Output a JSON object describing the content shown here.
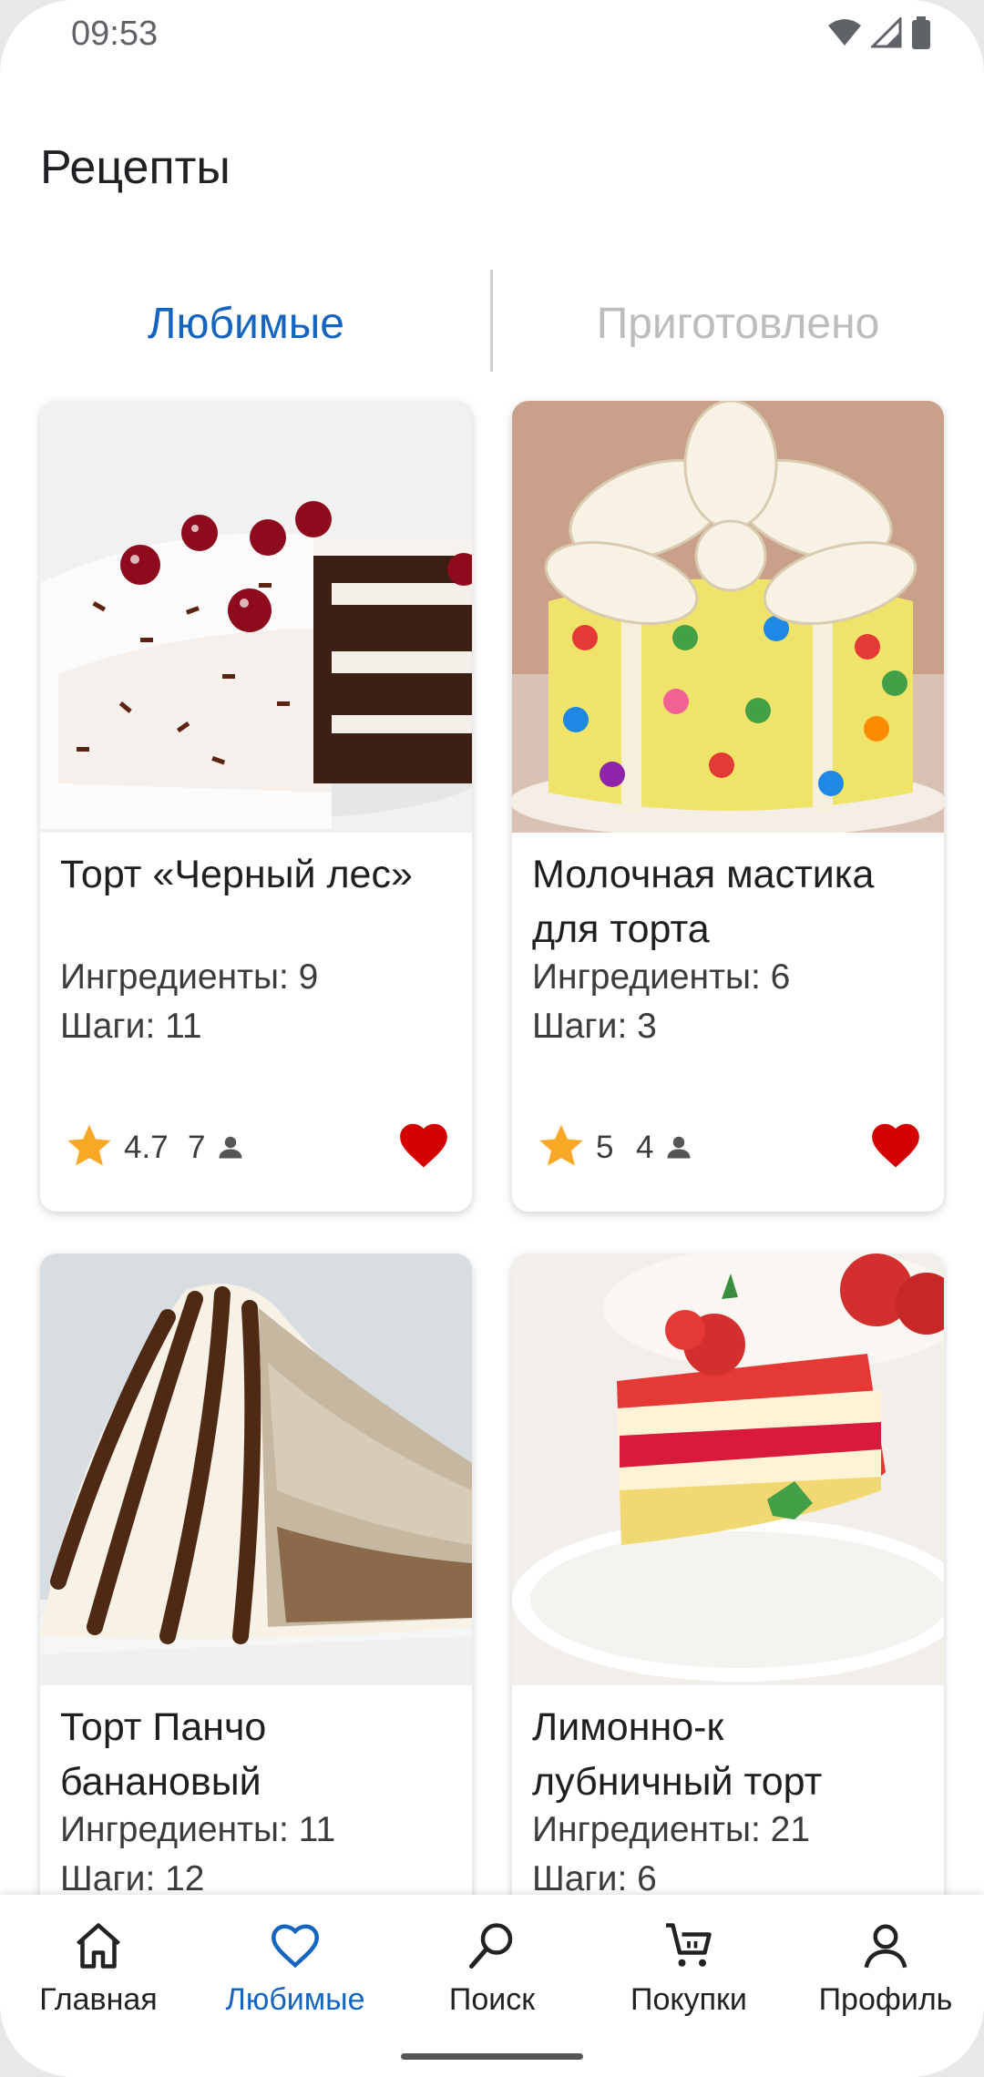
{
  "status_bar": {
    "time": "09:53"
  },
  "page_title": "Рецепты",
  "tabs": [
    {
      "label": "Любимые",
      "active": true
    },
    {
      "label": "Приготовлено",
      "active": false
    }
  ],
  "recipes": [
    {
      "title": "Торт «Черный лес»",
      "ingredients": "Ингредиенты: 9",
      "steps": "Шаги: 11",
      "rating": "4.7",
      "cooks": "7",
      "favorite": true,
      "image": "black-forest-cake"
    },
    {
      "title": "Молочная мастика для торта",
      "ingredients": "Ингредиенты: 6",
      "steps": "Шаги: 3",
      "rating": "5",
      "cooks": "4",
      "favorite": true,
      "image": "fondant-bow-cake"
    },
    {
      "title": "Торт Панчо банановый",
      "ingredients": "Ингредиенты: 11",
      "steps": "Шаги: 12",
      "image": "pancho-banana-cake"
    },
    {
      "title": "Лимонно-к лубничный торт",
      "ingredients": "Ингредиенты: 21",
      "steps": "Шаги: 6",
      "image": "strawberry-lemon-cake"
    }
  ],
  "bottom_nav": [
    {
      "label": "Главная",
      "icon": "home-icon",
      "active": false
    },
    {
      "label": "Любимые",
      "icon": "heart-outline-icon",
      "active": true
    },
    {
      "label": "Поиск",
      "icon": "search-icon",
      "active": false
    },
    {
      "label": "Покупки",
      "icon": "cart-icon",
      "active": false
    },
    {
      "label": "Профиль",
      "icon": "person-icon",
      "active": false
    }
  ],
  "colors": {
    "accent": "#1565c0",
    "heart": "#d50000",
    "star": "#f9a825",
    "inactive_tab": "#bdbdbd"
  }
}
